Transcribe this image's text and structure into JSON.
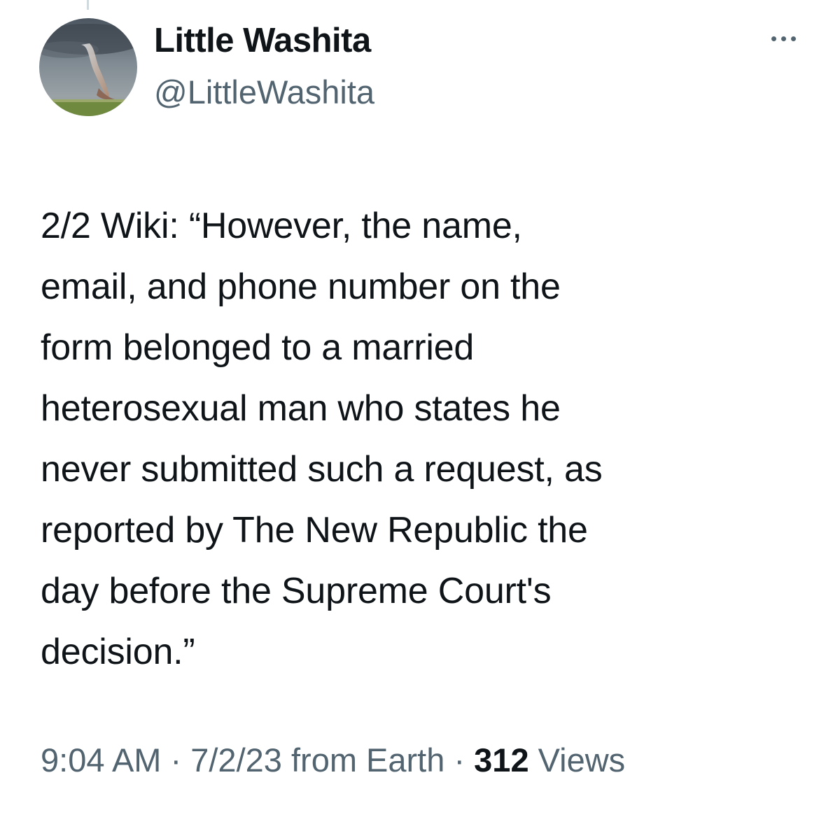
{
  "author": {
    "display_name": "Little Washita",
    "handle": "@LittleWashita",
    "avatar_icon": "tornado-avatar"
  },
  "tweet": {
    "text": "2/2 Wiki: “However, the name,\nemail, and phone number on the\nform belonged to a married\nheterosexual man who states he\nnever submitted such a request, as\nreported by The New Republic the\nday before the Supreme Court's\ndecision.”"
  },
  "meta": {
    "time": "9:04 AM",
    "separator": "·",
    "date": "7/2/23",
    "source": "from Earth",
    "views_count": "312",
    "views_label": "Views"
  },
  "menu": {
    "more_icon": "more-dots-icon"
  },
  "colors": {
    "text_primary": "#0f1419",
    "text_secondary": "#536471",
    "background": "#ffffff"
  }
}
